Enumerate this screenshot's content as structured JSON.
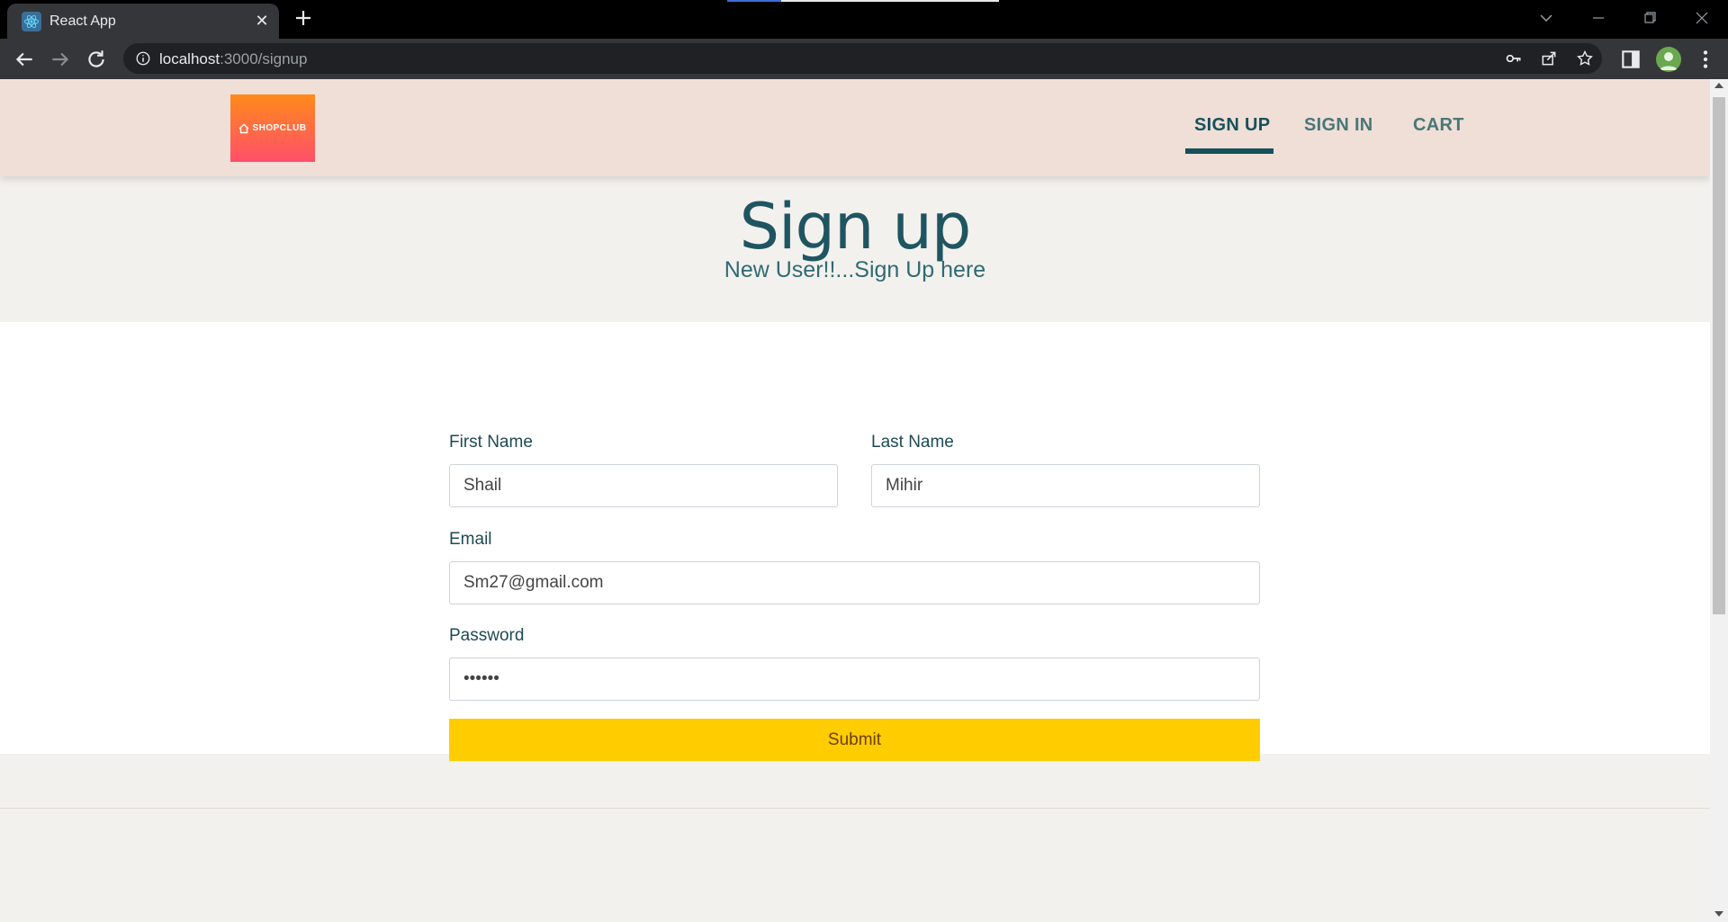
{
  "browser": {
    "tab_title": "React App",
    "tab_close": "✕",
    "new_tab": "+",
    "url_host": "localhost",
    "url_path": ":3000/signup"
  },
  "site": {
    "logo_text": "SHOPCLUB",
    "nav": [
      {
        "label": "SIGN UP",
        "active": true
      },
      {
        "label": "SIGN IN",
        "active": false
      },
      {
        "label": "CART",
        "active": false
      }
    ]
  },
  "hero": {
    "title": "Sign up",
    "subtitle": "New User!!...Sign Up here"
  },
  "form": {
    "first_name_label": "First Name",
    "first_name_value": "Shail",
    "last_name_label": "Last Name",
    "last_name_value": "Mihir",
    "email_label": "Email",
    "email_value": "Sm27@gmail.com",
    "password_label": "Password",
    "password_value": "••••••",
    "submit_label": "Submit"
  },
  "colors": {
    "header_bg": "#efdfd7",
    "accent": "#16515b",
    "submit_bg": "#ffcc00",
    "logo_gradient": [
      "#ff8a1a",
      "#ff4f6a"
    ]
  }
}
